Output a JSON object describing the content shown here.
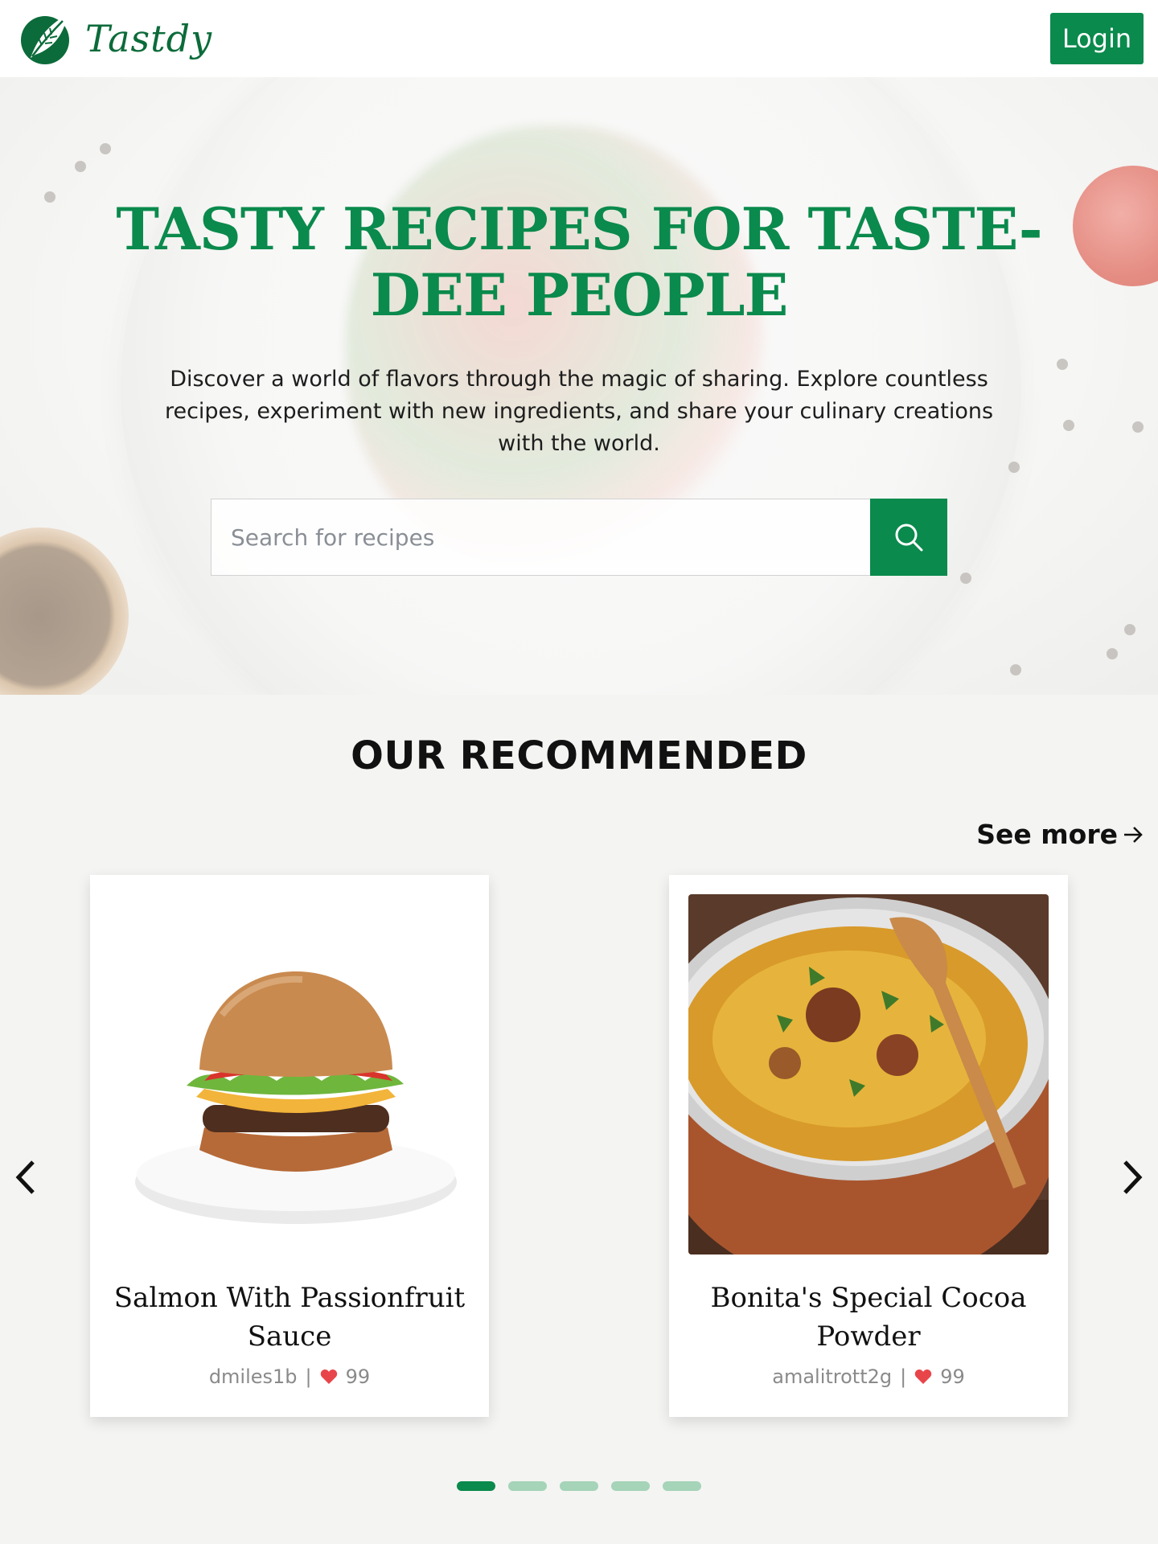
{
  "brand": {
    "name": "Tastdy",
    "color": "#0a8a4c"
  },
  "header": {
    "login_label": "Login"
  },
  "hero": {
    "title": "TASTY RECIPES FOR TASTE-DEE PEOPLE",
    "description": "Discover a world of flavors through the magic of sharing. Explore countless recipes, experiment with new ingredients, and share your culinary creations with the world.",
    "search_placeholder": "Search for recipes",
    "search_icon": "search-icon"
  },
  "recommended": {
    "title": "OUR RECOMMENDED",
    "see_more_label": "See more",
    "cards": [
      {
        "title": "Salmon With Passionfruit Sauce",
        "author": "dmiles1b",
        "separator": "|",
        "likes": "99",
        "image": "burger-image"
      },
      {
        "title": "Bonita's Special Cocoa Powder",
        "author": "amalitrott2g",
        "separator": "|",
        "likes": "99",
        "image": "biryani-image"
      }
    ],
    "pagination": {
      "total": 5,
      "active": 1
    }
  }
}
